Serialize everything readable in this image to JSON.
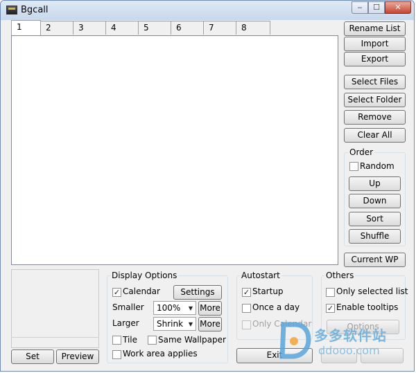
{
  "window": {
    "title": "Bgcall"
  },
  "tabs": [
    "1",
    "2",
    "3",
    "4",
    "5",
    "6",
    "7",
    "8"
  ],
  "list_buttons": {
    "rename": "Rename List",
    "import": "Import",
    "export": "Export",
    "select_files": "Select Files",
    "select_folder": "Select Folder",
    "remove": "Remove",
    "clear_all": "Clear All"
  },
  "order": {
    "label": "Order",
    "random_label": "Random",
    "random_checked": false,
    "up": "Up",
    "down": "Down",
    "sort": "Sort",
    "shuffle": "Shuffle"
  },
  "current_wp": "Current WP",
  "preview_panel": {
    "set": "Set",
    "preview": "Preview"
  },
  "display_options": {
    "label": "Display Options",
    "calendar_label": "Calendar",
    "calendar_checked": true,
    "settings": "Settings",
    "smaller_label": "Smaller",
    "smaller_value": "100%",
    "larger_label": "Larger",
    "larger_value": "Shrink",
    "more": "More",
    "tile_label": "Tile",
    "tile_checked": false,
    "same_wallpaper_label": "Same Wallpaper",
    "same_wallpaper_checked": false,
    "work_area_label": "Work area applies",
    "work_area_checked": false
  },
  "autostart": {
    "label": "Autostart",
    "startup_label": "Startup",
    "startup_checked": true,
    "once_a_day_label": "Once a day",
    "once_a_day_checked": false,
    "only_calendar_label": "Only Calendar",
    "only_calendar_checked": false
  },
  "others": {
    "label": "Others",
    "only_selected_label": "Only selected list",
    "only_selected_checked": false,
    "tooltips_label": "Enable tooltips",
    "tooltips_checked": true,
    "options": "Options"
  },
  "footer": {
    "exit": "Exit"
  },
  "watermark": {
    "brand": "多多软件站",
    "url": "ddooo.com"
  }
}
